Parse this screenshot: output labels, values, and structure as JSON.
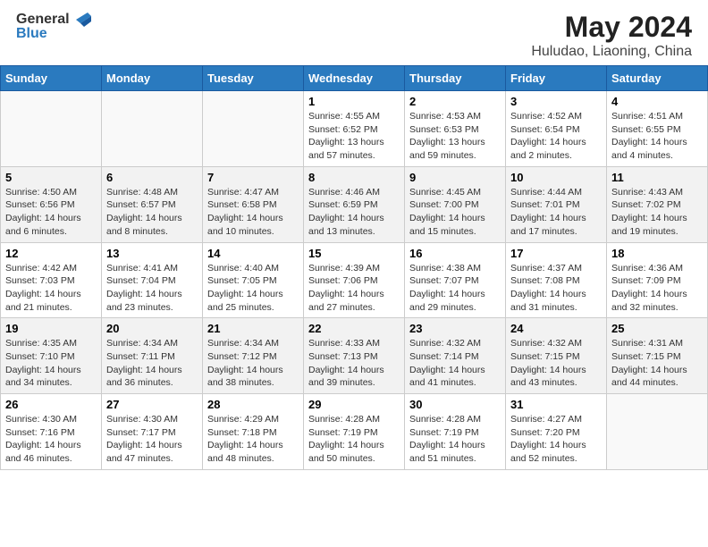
{
  "header": {
    "logo_general": "General",
    "logo_blue": "Blue",
    "title": "May 2024",
    "subtitle": "Huludao, Liaoning, China"
  },
  "weekdays": [
    "Sunday",
    "Monday",
    "Tuesday",
    "Wednesday",
    "Thursday",
    "Friday",
    "Saturday"
  ],
  "weeks": [
    [
      {
        "day": "",
        "info": ""
      },
      {
        "day": "",
        "info": ""
      },
      {
        "day": "",
        "info": ""
      },
      {
        "day": "1",
        "info": "Sunrise: 4:55 AM\nSunset: 6:52 PM\nDaylight: 13 hours\nand 57 minutes."
      },
      {
        "day": "2",
        "info": "Sunrise: 4:53 AM\nSunset: 6:53 PM\nDaylight: 13 hours\nand 59 minutes."
      },
      {
        "day": "3",
        "info": "Sunrise: 4:52 AM\nSunset: 6:54 PM\nDaylight: 14 hours\nand 2 minutes."
      },
      {
        "day": "4",
        "info": "Sunrise: 4:51 AM\nSunset: 6:55 PM\nDaylight: 14 hours\nand 4 minutes."
      }
    ],
    [
      {
        "day": "5",
        "info": "Sunrise: 4:50 AM\nSunset: 6:56 PM\nDaylight: 14 hours\nand 6 minutes."
      },
      {
        "day": "6",
        "info": "Sunrise: 4:48 AM\nSunset: 6:57 PM\nDaylight: 14 hours\nand 8 minutes."
      },
      {
        "day": "7",
        "info": "Sunrise: 4:47 AM\nSunset: 6:58 PM\nDaylight: 14 hours\nand 10 minutes."
      },
      {
        "day": "8",
        "info": "Sunrise: 4:46 AM\nSunset: 6:59 PM\nDaylight: 14 hours\nand 13 minutes."
      },
      {
        "day": "9",
        "info": "Sunrise: 4:45 AM\nSunset: 7:00 PM\nDaylight: 14 hours\nand 15 minutes."
      },
      {
        "day": "10",
        "info": "Sunrise: 4:44 AM\nSunset: 7:01 PM\nDaylight: 14 hours\nand 17 minutes."
      },
      {
        "day": "11",
        "info": "Sunrise: 4:43 AM\nSunset: 7:02 PM\nDaylight: 14 hours\nand 19 minutes."
      }
    ],
    [
      {
        "day": "12",
        "info": "Sunrise: 4:42 AM\nSunset: 7:03 PM\nDaylight: 14 hours\nand 21 minutes."
      },
      {
        "day": "13",
        "info": "Sunrise: 4:41 AM\nSunset: 7:04 PM\nDaylight: 14 hours\nand 23 minutes."
      },
      {
        "day": "14",
        "info": "Sunrise: 4:40 AM\nSunset: 7:05 PM\nDaylight: 14 hours\nand 25 minutes."
      },
      {
        "day": "15",
        "info": "Sunrise: 4:39 AM\nSunset: 7:06 PM\nDaylight: 14 hours\nand 27 minutes."
      },
      {
        "day": "16",
        "info": "Sunrise: 4:38 AM\nSunset: 7:07 PM\nDaylight: 14 hours\nand 29 minutes."
      },
      {
        "day": "17",
        "info": "Sunrise: 4:37 AM\nSunset: 7:08 PM\nDaylight: 14 hours\nand 31 minutes."
      },
      {
        "day": "18",
        "info": "Sunrise: 4:36 AM\nSunset: 7:09 PM\nDaylight: 14 hours\nand 32 minutes."
      }
    ],
    [
      {
        "day": "19",
        "info": "Sunrise: 4:35 AM\nSunset: 7:10 PM\nDaylight: 14 hours\nand 34 minutes."
      },
      {
        "day": "20",
        "info": "Sunrise: 4:34 AM\nSunset: 7:11 PM\nDaylight: 14 hours\nand 36 minutes."
      },
      {
        "day": "21",
        "info": "Sunrise: 4:34 AM\nSunset: 7:12 PM\nDaylight: 14 hours\nand 38 minutes."
      },
      {
        "day": "22",
        "info": "Sunrise: 4:33 AM\nSunset: 7:13 PM\nDaylight: 14 hours\nand 39 minutes."
      },
      {
        "day": "23",
        "info": "Sunrise: 4:32 AM\nSunset: 7:14 PM\nDaylight: 14 hours\nand 41 minutes."
      },
      {
        "day": "24",
        "info": "Sunrise: 4:32 AM\nSunset: 7:15 PM\nDaylight: 14 hours\nand 43 minutes."
      },
      {
        "day": "25",
        "info": "Sunrise: 4:31 AM\nSunset: 7:15 PM\nDaylight: 14 hours\nand 44 minutes."
      }
    ],
    [
      {
        "day": "26",
        "info": "Sunrise: 4:30 AM\nSunset: 7:16 PM\nDaylight: 14 hours\nand 46 minutes."
      },
      {
        "day": "27",
        "info": "Sunrise: 4:30 AM\nSunset: 7:17 PM\nDaylight: 14 hours\nand 47 minutes."
      },
      {
        "day": "28",
        "info": "Sunrise: 4:29 AM\nSunset: 7:18 PM\nDaylight: 14 hours\nand 48 minutes."
      },
      {
        "day": "29",
        "info": "Sunrise: 4:28 AM\nSunset: 7:19 PM\nDaylight: 14 hours\nand 50 minutes."
      },
      {
        "day": "30",
        "info": "Sunrise: 4:28 AM\nSunset: 7:19 PM\nDaylight: 14 hours\nand 51 minutes."
      },
      {
        "day": "31",
        "info": "Sunrise: 4:27 AM\nSunset: 7:20 PM\nDaylight: 14 hours\nand 52 minutes."
      },
      {
        "day": "",
        "info": ""
      }
    ]
  ]
}
